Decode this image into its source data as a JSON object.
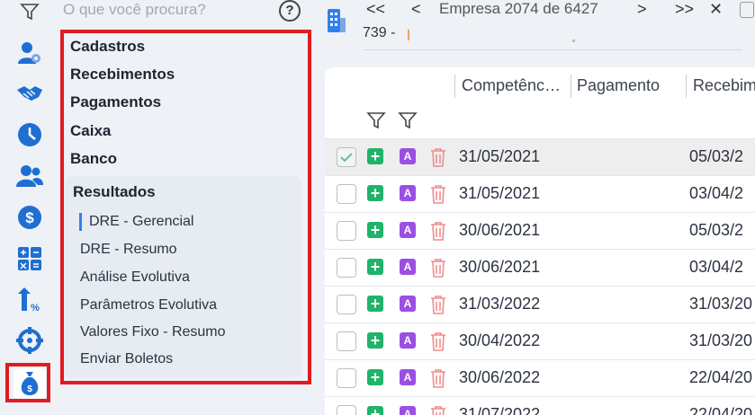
{
  "search": {
    "placeholder": "O que você procura?",
    "help_label": "?"
  },
  "menu": {
    "categories": [
      "Cadastros",
      "Recebimentos",
      "Pagamentos",
      "Caixa",
      "Banco"
    ],
    "submenu": {
      "title": "Resultados",
      "items": [
        "DRE - Gerencial",
        "DRE - Resumo",
        "Análise Evolutiva",
        "Parâmetros Evolutiva",
        "Valores Fixo - Resumo",
        "Enviar Boletos"
      ],
      "active_index": 0
    }
  },
  "topbar": {
    "first": "<<",
    "prev": "<",
    "next": ">",
    "last": ">>",
    "close": "✕",
    "empresa_text": "Empresa 2074 de 6427",
    "code": "739 -"
  },
  "table": {
    "columns": [
      "Competênc…",
      "Pagamento",
      "Recebim"
    ],
    "rows": [
      {
        "competencia": "31/05/2021",
        "recebimento": "05/03/2",
        "checked": true,
        "add": "+",
        "a": "A"
      },
      {
        "competencia": "31/05/2021",
        "recebimento": "03/04/2",
        "checked": false,
        "add": "+",
        "a": "A"
      },
      {
        "competencia": "30/06/2021",
        "recebimento": "05/03/2",
        "checked": false,
        "add": "+",
        "a": "A"
      },
      {
        "competencia": "30/06/2021",
        "recebimento": "03/04/2",
        "checked": false,
        "add": "+",
        "a": "A"
      },
      {
        "competencia": "31/03/2022",
        "recebimento": "31/03/20",
        "checked": false,
        "add": "+",
        "a": "A"
      },
      {
        "competencia": "30/04/2022",
        "recebimento": "31/03/20",
        "checked": false,
        "add": "+",
        "a": "A"
      },
      {
        "competencia": "30/06/2022",
        "recebimento": "22/04/20",
        "checked": false,
        "add": "+",
        "a": "A"
      },
      {
        "competencia": "31/07/2022",
        "recebimento": "22/04/20",
        "checked": false,
        "add": "+",
        "a": "A"
      }
    ]
  },
  "colors": {
    "accent_red": "#e01b22",
    "active_blue": "#2f80ed",
    "green": "#20b36a",
    "purple": "#9b4fe3",
    "trash": "#f28b8b"
  }
}
